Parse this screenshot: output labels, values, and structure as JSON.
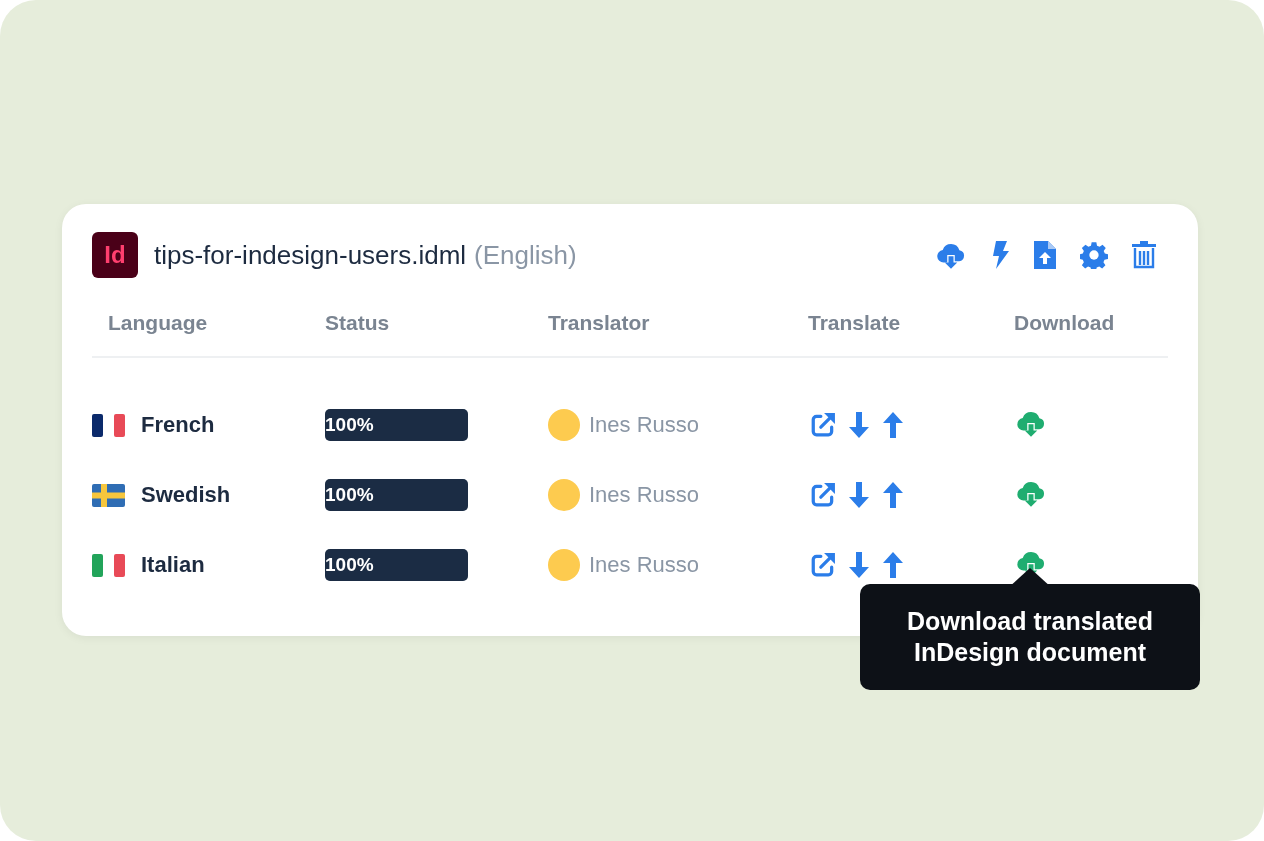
{
  "file": {
    "app_icon": "Id",
    "name": "tips-for-indesign-users.idml",
    "source_language": "(English)"
  },
  "columns": [
    "Language",
    "Status",
    "Translator",
    "Translate",
    "Download"
  ],
  "rows": [
    {
      "language": "French",
      "kind": "tricolor-blue",
      "status": "100%",
      "level": 1,
      "translator": "Ines Russo",
      "color": "#fdcb4f"
    },
    {
      "language": "Swedish",
      "kind": "cross",
      "status": "100%",
      "level": 1,
      "translator": "Ines Russo",
      "color": "#fdcb4f"
    },
    {
      "language": "Italian",
      "kind": "tricolor-green",
      "status": "100%",
      "level": 1,
      "translator": "Ines Russo",
      "color": "#fdcb4f",
      "tooltip": "Download translated InDesign document"
    }
  ]
}
